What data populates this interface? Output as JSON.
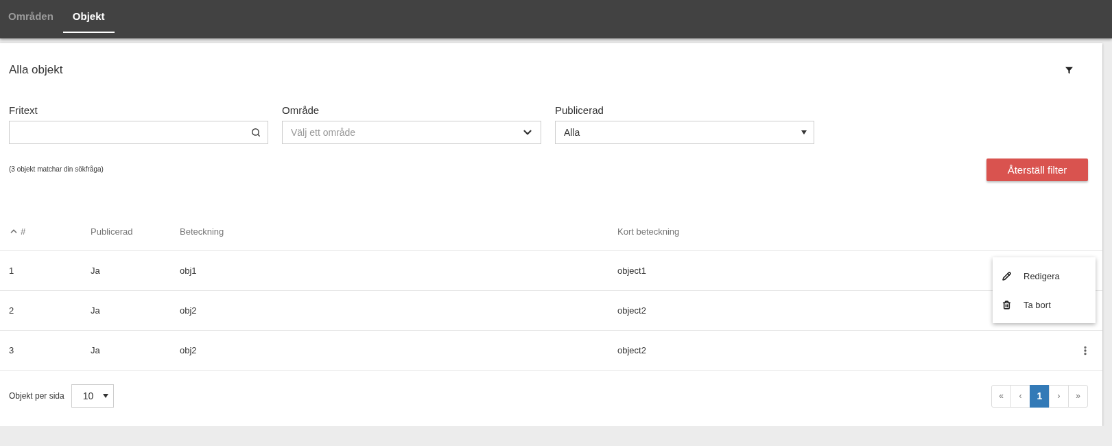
{
  "nav": {
    "tabs": [
      {
        "label": "Områden",
        "selected": false
      },
      {
        "label": "Objekt",
        "selected": true
      }
    ]
  },
  "panel": {
    "title": "Alla objekt",
    "filters": [
      {
        "kind": "search",
        "label": "Fritext"
      },
      {
        "kind": "combo",
        "label": "Område",
        "placeholder": "Välj ett område"
      },
      {
        "kind": "select",
        "label": "Publicerad",
        "value": "Alla"
      }
    ],
    "match_count": "(3 objekt matchar din sökfråga)",
    "reset_button": "Återställ filter"
  },
  "table": {
    "columns": [
      "#",
      "Publicerad",
      "Beteckning",
      "Kort beteckning"
    ],
    "rows": [
      {
        "cells": [
          "1",
          "Ja",
          "obj1",
          "object1"
        ]
      },
      {
        "cells": [
          "2",
          "Ja",
          "obj2",
          "object2"
        ]
      },
      {
        "cells": [
          "3",
          "Ja",
          "obj2",
          "object2"
        ]
      }
    ]
  },
  "row_menu": {
    "items": [
      {
        "kind": "edit",
        "label": "Redigera"
      },
      {
        "kind": "delete",
        "label": "Ta bort"
      }
    ]
  },
  "footer": {
    "per_page_label": "Objekt per sida",
    "per_page": "10",
    "pagination": [
      {
        "label": "«",
        "selected": false
      },
      {
        "label": "‹",
        "selected": false
      },
      {
        "label": "1",
        "selected": true
      },
      {
        "label": "›",
        "selected": false
      },
      {
        "label": "»",
        "selected": false
      }
    ]
  }
}
